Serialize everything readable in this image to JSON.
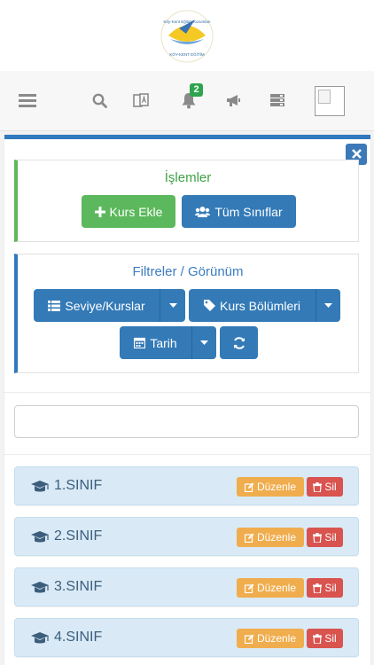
{
  "header": {
    "logo_top": "Köy-Kent Eğitim Kurumları",
    "logo_bottom": "KÖY-KENT EĞİTİM",
    "notification_count": "2",
    "icons": [
      "menu-icon",
      "search-icon",
      "language-icon",
      "bell-icon",
      "megaphone-icon",
      "server-icon",
      "avatar-image"
    ]
  },
  "actions": {
    "title": "İşlemler",
    "add_course_label": "Kurs Ekle",
    "all_classes_label": "Tüm Sınıflar"
  },
  "filters": {
    "title": "Filtreler / Görünüm",
    "level_courses_label": "Seviye/Kurslar",
    "course_sections_label": "Kurs Bölümleri",
    "date_label": "Tarih"
  },
  "search": {
    "placeholder": ""
  },
  "classes": [
    {
      "name": "1.SINIF",
      "edit_label": "Düzenle",
      "delete_label": "Sil"
    },
    {
      "name": "2.SINIF",
      "edit_label": "Düzenle",
      "delete_label": "Sil"
    },
    {
      "name": "3.SINIF",
      "edit_label": "Düzenle",
      "delete_label": "Sil"
    },
    {
      "name": "4.SINIF",
      "edit_label": "Düzenle",
      "delete_label": "Sil"
    }
  ],
  "colors": {
    "primary": "#337ab7",
    "success": "#5cb85c",
    "warning": "#f0ad4e",
    "danger": "#d9534f",
    "list_bg": "#d9eaf6"
  }
}
